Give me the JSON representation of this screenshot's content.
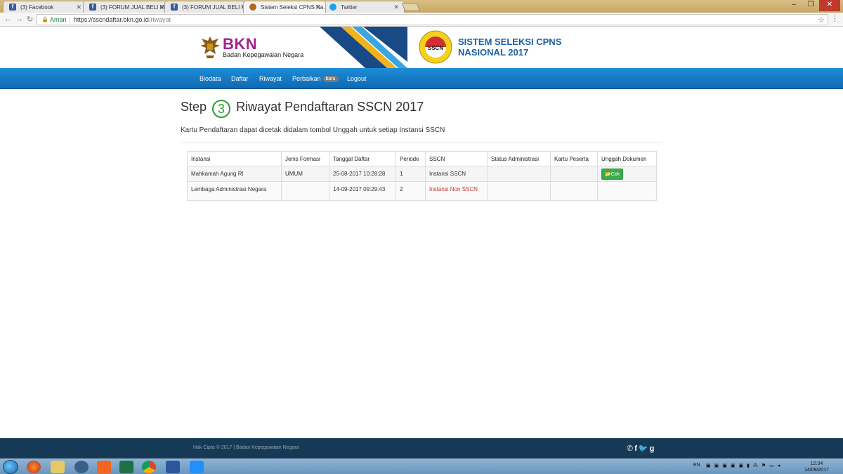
{
  "browser": {
    "tabs": [
      {
        "title": "(3) Facebook",
        "favicon": "facebook-icon",
        "active": false
      },
      {
        "title": "(3) FORUM JUAL BELI M...",
        "favicon": "facebook-icon",
        "active": false
      },
      {
        "title": "(3) FORUM JUAL BELI M...",
        "favicon": "facebook-icon",
        "active": false
      },
      {
        "title": "Sistem Seleksi CPNS Na...",
        "favicon": "garuda-icon",
        "active": true
      },
      {
        "title": "Twitter",
        "favicon": "twitter-icon",
        "active": false
      }
    ],
    "address": {
      "security_label": "Aman",
      "host": "https://sscndaftar.bkn.go.id",
      "path": "/riwayat"
    }
  },
  "header": {
    "bkn_name": "BKN",
    "bkn_subtitle": "Badan Kepegawaian Negara",
    "sscn_title_line1": "SISTEM SELEKSI CPNS",
    "sscn_title_line2": "NASIONAL 2017",
    "sscn_seal_text": "SSCN"
  },
  "nav": {
    "items": [
      "Biodata",
      "Daftar",
      "Riwayat",
      "Perbaikan",
      "Logout"
    ],
    "perbaikan_badge": "baru"
  },
  "main": {
    "title_prefix": "Step",
    "step_number": "3",
    "title_suffix": "Riwayat Pendaftaran SSCN 2017",
    "subtitle": "Kartu Pendaftaran dapat dicetak didalam tombol Unggah untuk setiap Instansi SSCN",
    "table": {
      "headers": [
        "Instansi",
        "Jenis Formasi",
        "Tanggal Daftar",
        "Periode",
        "SSCN",
        "Status Administrasi",
        "Kartu Peserta",
        "Unggah Dokumen"
      ],
      "rows": [
        {
          "instansi": "Mahkamah Agung RI",
          "jenis_formasi": "UMUM",
          "tanggal_daftar": "25-08-2017 10:28:28",
          "periode": "1",
          "sscn": "Instansi SSCN",
          "status_administrasi": "",
          "kartu_peserta": "",
          "unggah_label": "Cek"
        },
        {
          "instansi": "Lembaga Administrasi Negara",
          "jenis_formasi": "",
          "tanggal_daftar": "14-09-2017 09:29:43",
          "periode": "2",
          "sscn": "Instansi Non SSCN",
          "status_administrasi": "",
          "kartu_peserta": "",
          "unggah_label": ""
        }
      ]
    }
  },
  "footer": {
    "copyright": "Hak Cipta © 2017 | Badan Kepegawaian Negara"
  },
  "taskbar": {
    "language": "EN",
    "time": "12:34",
    "date": "14/09/2017"
  },
  "colors": {
    "nav_blue": "#1a82cc",
    "bkn_purple": "#a3238e",
    "footer_navy": "#163a56",
    "button_green": "#3cab4b",
    "non_sscn_red": "#c0392b"
  }
}
